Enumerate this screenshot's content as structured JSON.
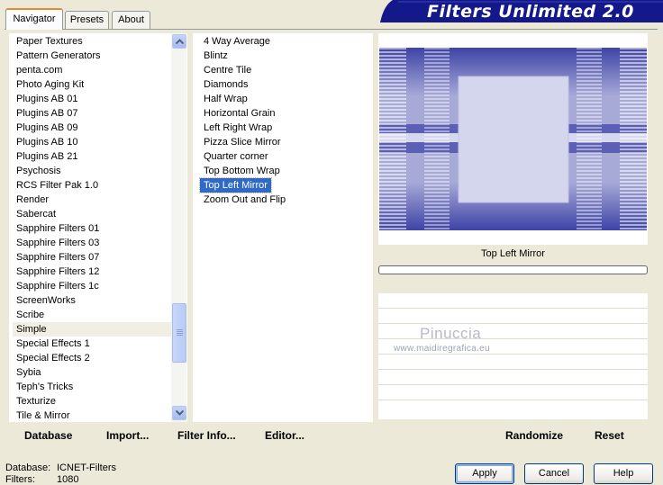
{
  "banner": {
    "title": "Filters Unlimited 2.0"
  },
  "tabs": [
    {
      "label": "Navigator"
    },
    {
      "label": "Presets"
    },
    {
      "label": "About"
    }
  ],
  "categories": [
    "Paper Textures",
    "Pattern Generators",
    "penta.com",
    "Photo Aging Kit",
    "Plugins AB 01",
    "Plugins AB 07",
    "Plugins AB 09",
    "Plugins AB 10",
    "Plugins AB 21",
    "Psychosis",
    "RCS Filter Pak 1.0",
    "Render",
    "Sabercat",
    "Sapphire Filters 01",
    "Sapphire Filters 03",
    "Sapphire Filters 07",
    "Sapphire Filters 12",
    "Sapphire Filters 1c",
    "ScreenWorks",
    "Scribe",
    "Simple",
    "Special Effects 1",
    "Special Effects 2",
    "Sybia",
    "Teph's Tricks",
    "Texturize",
    "Tile & Mirror"
  ],
  "filters": [
    "4 Way Average",
    "Blintz",
    "Centre Tile",
    "Diamonds",
    "Half Wrap",
    "Horizontal Grain",
    "Left Right Wrap",
    "Pizza Slice Mirror",
    "Quarter corner",
    "Top Bottom Wrap",
    "Top Left Mirror",
    "Zoom Out and Flip"
  ],
  "selected_category": "Simple",
  "selected_filter": "Top Left Mirror",
  "preview": {
    "filter_name": "Top Left Mirror",
    "progress": 0
  },
  "watermark": {
    "name": "Pinuccia",
    "url": "www.maidiregrafica.eu"
  },
  "toolbar": {
    "database_label": "Database",
    "import_label": "Import...",
    "filter_info_label": "Filter Info...",
    "editor_label": "Editor...",
    "randomize_label": "Randomize",
    "reset_label": "Reset"
  },
  "status": {
    "database_label": "Database:",
    "database_value": "ICNET-Filters",
    "filters_label": "Filters:",
    "filters_value": "1080"
  },
  "buttons": {
    "apply": "Apply",
    "cancel": "Cancel",
    "help": "Help"
  },
  "colors": {
    "accent": "#1a1f8f",
    "selection": "#316ac5",
    "preview_tint": "#5a5fb0"
  }
}
